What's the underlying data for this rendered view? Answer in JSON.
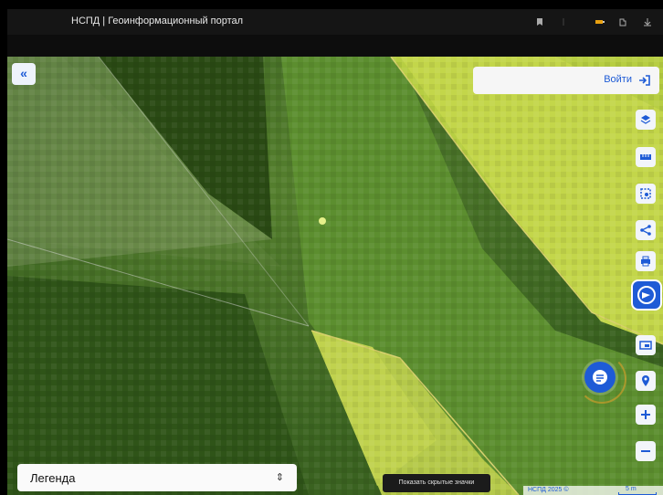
{
  "window": {
    "title": "НСПД | Геоинформационный портал"
  },
  "header": {
    "login_label": "Войти"
  },
  "legend": {
    "label": "Легенда",
    "chevron": "⌃⌄"
  },
  "tooltip": {
    "text": "Показать скрытые значки"
  },
  "footer": {
    "copyright": "НСПД 2025 ©",
    "scale": "5 m"
  },
  "toolbar": {
    "icons": [
      "layers-icon",
      "ruler-icon",
      "select-area-icon",
      "share-icon",
      "print-icon",
      "help-icon",
      "basemap-icon",
      "geolocation-icon",
      "zoom-in-icon",
      "zoom-out-icon"
    ]
  },
  "colors": {
    "accent": "#1e5bd6",
    "map_dark": "#3f6a22",
    "map_light": "#c3d64a"
  }
}
